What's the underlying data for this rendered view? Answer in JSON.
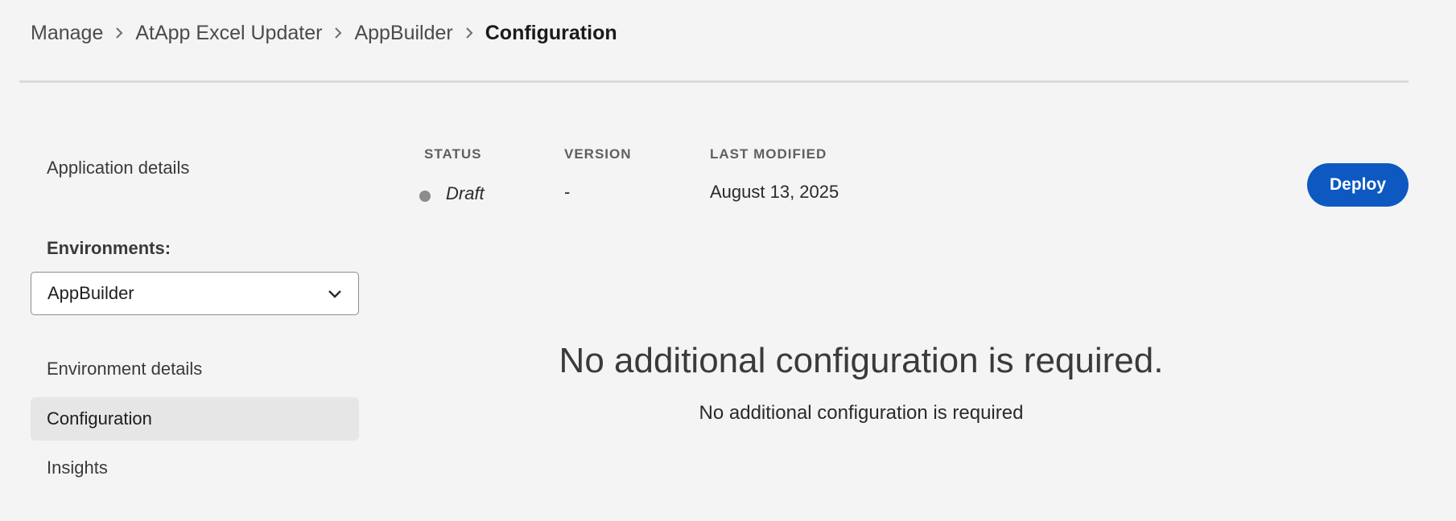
{
  "breadcrumb": {
    "items": [
      "Manage",
      "AtApp Excel Updater",
      "AppBuilder"
    ],
    "current": "Configuration",
    "separator_icon": "chevron-right-icon"
  },
  "sidebar": {
    "application_details": "Application details",
    "environments_label": "Environments:",
    "environment_select": {
      "value": "AppBuilder",
      "icon": "chevron-down-icon"
    },
    "links": [
      {
        "label": "Environment details",
        "selected": false
      },
      {
        "label": "Configuration",
        "selected": true
      },
      {
        "label": "Insights",
        "selected": false
      }
    ]
  },
  "meta": {
    "status_label": "STATUS",
    "status_value": "Draft",
    "status_color": "#8c8c8c",
    "version_label": "VERSION",
    "version_value": "-",
    "last_modified_label": "LAST MODIFIED",
    "last_modified_value": "August 13, 2025"
  },
  "deploy_button": {
    "label": "Deploy",
    "color": "#0d59c1"
  },
  "empty_state": {
    "heading": "No additional configuration is required.",
    "subtext": "No additional configuration is required"
  }
}
